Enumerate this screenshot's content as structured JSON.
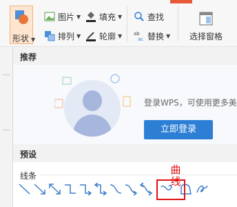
{
  "ribbon": {
    "shape_label": "形状",
    "picture_label": "图片",
    "fill_label": "填充",
    "arrange_label": "排列",
    "outline_label": "轮廓",
    "find_label": "查找",
    "replace_label": "替换",
    "selection_pane_label": "选择窗格"
  },
  "panel": {
    "recommend_header": "推荐",
    "promo_text": "登录WPS，可使用更多美",
    "login_button": "立即登录",
    "preset_header": "预设",
    "lines_label": "线条"
  },
  "annotation": {
    "label": "曲线",
    "color": "#e01010"
  },
  "shape_icons": [
    "line-icon",
    "arrow-line-icon",
    "double-arrow-line-icon",
    "elbow-connector-icon",
    "elbow-arrow-connector-icon",
    "elbow-double-arrow-connector-icon",
    "curved-connector-icon",
    "curved-arrow-connector-icon",
    "curved-double-arrow-connector-icon",
    "curve-icon",
    "freeform-icon",
    "scribble-icon"
  ],
  "colors": {
    "accent": "#2d7fd6",
    "highlight": "#e01010",
    "shape_selected": "#fde5cf"
  }
}
